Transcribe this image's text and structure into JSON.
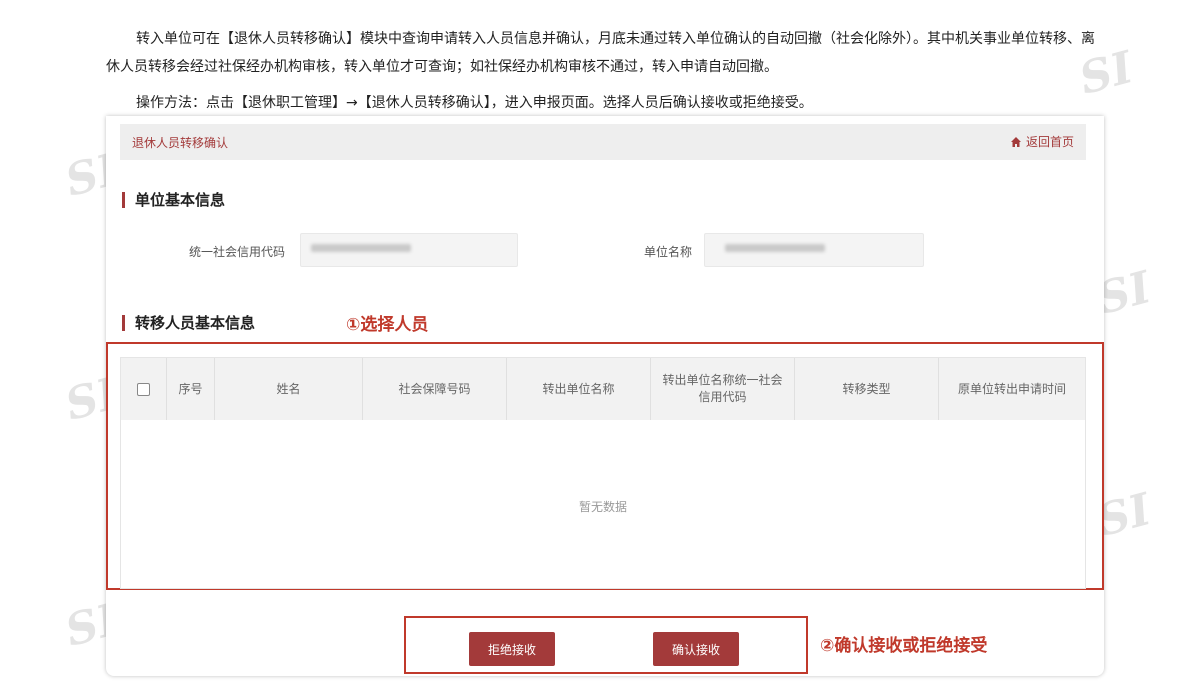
{
  "intro": {
    "paragraph1": "转入单位可在【退休人员转移确认】模块中查询申请转入人员信息并确认，月底未通过转入单位确认的自动回撤（社会化除外）。其中机关事业单位转移、离休人员转移会经过社保经办机构审核，转入单位才可查询；如社保经办机构审核不通过，转入申请自动回撤。",
    "paragraph2": "操作方法：点击【退休职工管理】→【退休人员转移确认】，进入申报页面。选择人员后确认接收或拒绝接受。"
  },
  "watermark_text": "SI",
  "app": {
    "breadcrumb": "退休人员转移确认",
    "home_link": "返回首页",
    "section_basic": "单位基本信息",
    "credit_code_label": "统一社会信用代码",
    "unit_name_label": "单位名称",
    "section_transfer": "转移人员基本信息",
    "table": {
      "headers": [
        "序号",
        "姓名",
        "社会保障号码",
        "转出单位名称",
        "转出单位名称统一社会信用代码",
        "转移类型",
        "原单位转出申请时间"
      ],
      "empty_text": "暂无数据"
    },
    "reject_button": "拒绝接收",
    "confirm_button": "确认接收"
  },
  "annotations": {
    "step1": "①选择人员",
    "step2": "②确认接收或拒绝接受"
  },
  "colors": {
    "accent": "#a33a3a",
    "annotation": "#c0392b"
  }
}
